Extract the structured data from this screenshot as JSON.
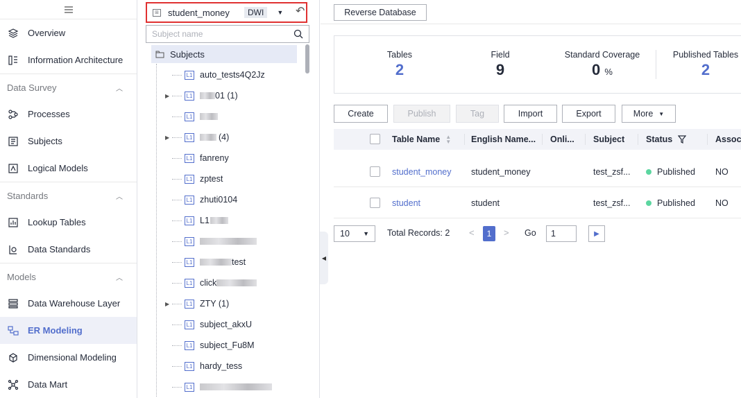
{
  "nav": {
    "items_top": [
      {
        "label": "Overview",
        "icon": "layers-icon"
      },
      {
        "label": "Information Architecture",
        "icon": "architecture-icon"
      }
    ],
    "groups": [
      {
        "label": "Data Survey",
        "items": [
          {
            "label": "Processes",
            "icon": "process-icon"
          },
          {
            "label": "Subjects",
            "icon": "subjects-icon"
          },
          {
            "label": "Logical Models",
            "icon": "logical-model-icon"
          }
        ]
      },
      {
        "label": "Standards",
        "items": [
          {
            "label": "Lookup Tables",
            "icon": "lookup-table-icon"
          },
          {
            "label": "Data Standards",
            "icon": "data-standard-icon"
          }
        ]
      },
      {
        "label": "Models",
        "items": [
          {
            "label": "Data Warehouse Layer",
            "icon": "warehouse-layer-icon"
          },
          {
            "label": "ER Modeling",
            "icon": "er-modeling-icon",
            "active": true
          },
          {
            "label": "Dimensional Modeling",
            "icon": "dimensional-icon"
          },
          {
            "label": "Data Mart",
            "icon": "data-mart-icon"
          }
        ]
      }
    ]
  },
  "tree": {
    "model_select": {
      "value": "student_money",
      "tag": "DWI"
    },
    "search_placeholder": "Subject name",
    "root_label": "Subjects",
    "level_tag": "L1",
    "items": [
      {
        "label": "auto_tests4Q2Jz"
      },
      {
        "label": "01 (1)"
      },
      {
        "label": ""
      },
      {
        "label": "(4)"
      },
      {
        "label": "fanreny"
      },
      {
        "label": "zptest"
      },
      {
        "label": "zhuti0104"
      },
      {
        "label": "L1"
      },
      {
        "label": ""
      },
      {
        "label": "test"
      },
      {
        "label": "click"
      },
      {
        "label": "ZTY (1)"
      },
      {
        "label": "subject_akxU"
      },
      {
        "label": "subject_Fu8M"
      },
      {
        "label": "hardy_tess"
      },
      {
        "label": ""
      }
    ]
  },
  "toolbar": {
    "reverse_db": "Reverse Database"
  },
  "stats": {
    "tables": {
      "label": "Tables",
      "value": "2"
    },
    "field": {
      "label": "Field",
      "value": "9"
    },
    "coverage": {
      "label": "Standard Coverage",
      "value": "0",
      "unit": "%"
    },
    "published": {
      "label": "Published Tables",
      "value": "2"
    }
  },
  "actions": {
    "create": "Create",
    "publish": "Publish",
    "tag": "Tag",
    "import": "Import",
    "export": "Export",
    "more": "More"
  },
  "table": {
    "columns": [
      "Table Name",
      "English Name...",
      "Onli...",
      "Subject",
      "Status",
      "Associ"
    ],
    "rows": [
      {
        "name": "student_money",
        "english": "student_money",
        "online": "",
        "subject": "test_zsf...",
        "status": "Published",
        "assoc": "NO"
      },
      {
        "name": "student",
        "english": "student",
        "online": "",
        "subject": "test_zsf...",
        "status": "Published",
        "assoc": "NO"
      }
    ]
  },
  "pagination": {
    "page_size": "10",
    "total": "Total Records: 2",
    "current": "1",
    "go_label": "Go",
    "go_value": "1"
  },
  "colors": {
    "accent": "#526ecc",
    "published": "#5cd6a0",
    "highlight_border": "#e03131"
  }
}
